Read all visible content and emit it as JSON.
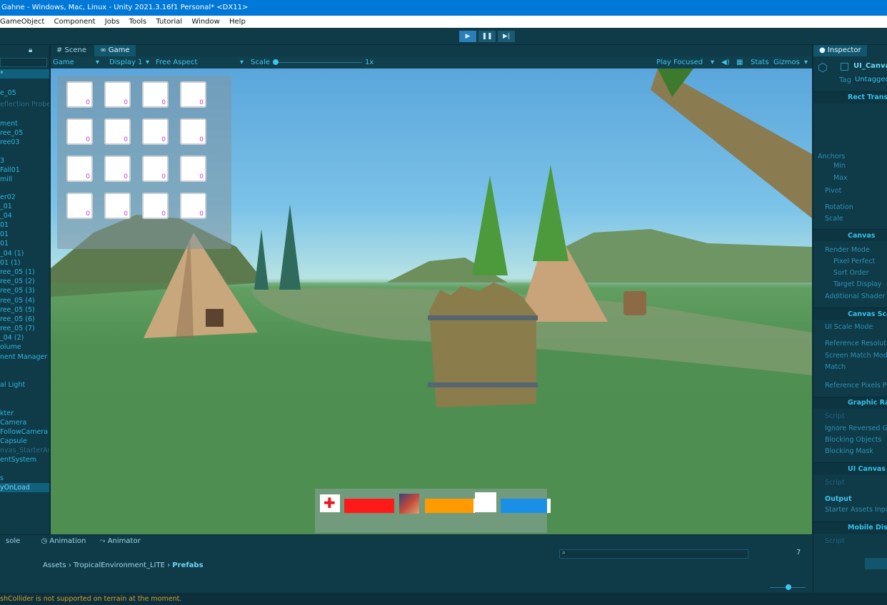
{
  "titlebar": {
    "text": "Gahne - Windows, Mac, Linux - Unity 2021.3.16f1 Personal* <DX11>"
  },
  "menu": {
    "items": [
      "GameObject",
      "Component",
      "Jobs",
      "Tools",
      "Tutorial",
      "Window",
      "Help"
    ]
  },
  "toolbar": {
    "play_icon": "play-icon",
    "pause_icon": "pause-icon",
    "step_icon": "step-icon",
    "active_color": "#2b7fb8"
  },
  "scene_tabs": {
    "scene": "# Scene",
    "game": "Game"
  },
  "gamebar": {
    "mode": "Game",
    "display": "Display 1",
    "aspect": "Free Aspect",
    "scale_label": "Scale",
    "scale_value": "1x",
    "play_focused": "Play Focused",
    "stats": "Stats",
    "gizmos": "Gizmos"
  },
  "hierarchy": {
    "items": [
      "e_05",
      "eflection Probe",
      "ment",
      "ree_05",
      "ree03",
      "3",
      "Fall01",
      "mill",
      "er02",
      "_01",
      "_04",
      "01",
      "01",
      "01",
      "_04 (1)",
      "01 (1)",
      "ree_05 (1)",
      "ree_05 (2)",
      "ree_05 (3)",
      "ree_05 (4)",
      "ree_05 (5)",
      "ree_05 (6)",
      "ree_05 (7)",
      "_04 (2)",
      "olume",
      "nent Manager",
      "al Light",
      "kter",
      "Camera",
      "FollowCamera",
      "Capsule",
      "nvas_StarterAs",
      "entSystem",
      "s",
      "yOnLoad"
    ]
  },
  "inventory": {
    "slot_count_label": "0",
    "slots": [
      "0",
      "0",
      "0",
      "0",
      "0",
      "0",
      "0",
      "0",
      "0",
      "0",
      "0",
      "0",
      "0",
      "0",
      "0",
      "0"
    ]
  },
  "hud": {
    "health_color": "#ff1a1a",
    "stamina_color": "#ff9a00",
    "mana_color": "#1a8fe8",
    "health_fill": 1.0,
    "stamina_fill": 0.97,
    "mana_fill": 0.93
  },
  "inspector": {
    "tab": "Inspector",
    "object_name": "UI_Canvas",
    "tag_label": "Tag",
    "tag_value": "Untagged",
    "components": {
      "rect_transform": "Rect Transf",
      "anchors": "Anchors",
      "min": "Min",
      "max": "Max",
      "pivot": "Pivot",
      "rotation": "Rotation",
      "scale": "Scale",
      "canvas": "Canvas",
      "render_mode": "Render Mode",
      "pixel_perfect": "Pixel Perfect",
      "sort_order": "Sort Order",
      "target_display": "Target Display",
      "additional_shader": "Additional Shader C",
      "canvas_scaler": "Canvas Sca",
      "ui_scale_mode": "UI Scale Mode",
      "reference_resolution": "Reference Resoluti",
      "screen_match_mode": "Screen Match Mod",
      "match": "Match",
      "reference_pixels": "Reference Pixels Pe",
      "graphic_raycaster": "Graphic Ray",
      "script": "Script",
      "ignore_reversed": "Ignore Reversed Gr",
      "blocking_objects": "Blocking Objects",
      "blocking_mask": "Blocking Mask",
      "ui_canvas_component": "UI Canvas C",
      "script2": "Script",
      "output": "Output",
      "starter_assets": "Starter Assets Input",
      "mobile_disable": "Mobile Disa",
      "script3": "Script"
    }
  },
  "bottom": {
    "tabs": [
      "sole",
      "Animation",
      "Animator"
    ],
    "breadcrumb": [
      "Assets",
      "TropicalEnvironment_LITE",
      "Prefabs"
    ],
    "hidden_count": "7"
  },
  "console": {
    "message": "shCollider is not supported on terrain at the moment."
  }
}
